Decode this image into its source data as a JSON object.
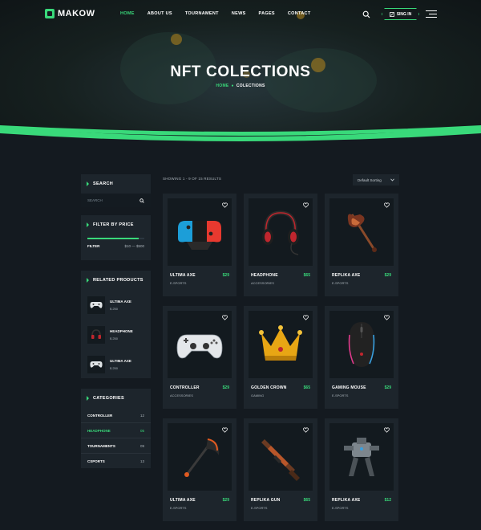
{
  "nav": {
    "logo": "MAKOW",
    "menu": [
      "HOME",
      "ABOUT US",
      "TOURNAMENT",
      "NEWS",
      "PAGES",
      "CONTACT"
    ],
    "active_index": 0,
    "signin_label": "SING IN"
  },
  "hero": {
    "title": "NFT COLECTIONS",
    "breadcrumb_home": "HOME",
    "breadcrumb_current": "COLECTIONS"
  },
  "sidebar": {
    "search": {
      "title": "SEARCH",
      "placeholder": "SEARCH"
    },
    "filter": {
      "title": "FILTER BY PRICE",
      "button": "FILTER",
      "range": "$10 — $500",
      "fill_fraction": 0.9
    },
    "related": {
      "title": "RELATED PRODUCTS",
      "items": [
        {
          "name": "ULTIMA AXE",
          "price": "$ 250",
          "icon": "gamepad-icon"
        },
        {
          "name": "HEADPHONE",
          "price": "$ 250",
          "icon": "headphone-icon"
        },
        {
          "name": "ULTIMA AXE",
          "price": "$ 250",
          "icon": "gamepad-icon"
        }
      ]
    },
    "categories": {
      "title": "CATEGORIES",
      "items": [
        {
          "name": "CONTROLLER",
          "count": "12"
        },
        {
          "name": "HEADPHONE",
          "count": "05"
        },
        {
          "name": "TOURNAMENTS",
          "count": "09"
        },
        {
          "name": "CSPORTS",
          "count": "13"
        }
      ],
      "active_index": 1
    }
  },
  "shop": {
    "results_text": "SHOWING 1 - 9 OF 15 RESULTS",
    "sorting": "Default Sorting",
    "products": [
      {
        "name": "ULTIMA AXE",
        "price": "$29",
        "category": "E-SPORTS",
        "icon": "switch-controller-icon"
      },
      {
        "name": "HEADPHONE",
        "price": "$65",
        "category": "ACCESSORIES",
        "icon": "headphone-icon"
      },
      {
        "name": "REPLIKA AXE",
        "price": "$29",
        "category": "E-SPORTS",
        "icon": "axe-icon"
      },
      {
        "name": "CONTROLLER",
        "price": "$29",
        "category": "ACCESSORIES",
        "icon": "gamepad-icon"
      },
      {
        "name": "GOLDEN CROWN",
        "price": "$65",
        "category": "GAMING",
        "icon": "crown-icon"
      },
      {
        "name": "GAMING MOUSE",
        "price": "$29",
        "category": "E-SPORTS",
        "icon": "mouse-icon"
      },
      {
        "name": "ULTIMA AXE",
        "price": "$29",
        "category": "E-SPORTS",
        "icon": "scythe-icon"
      },
      {
        "name": "REPLIKA GUN",
        "price": "$65",
        "category": "E-SPORTS",
        "icon": "rifle-icon"
      },
      {
        "name": "REPLIKA AXE",
        "price": "$12",
        "category": "E-SPORTS",
        "icon": "mech-robot-icon"
      }
    ]
  },
  "colors": {
    "accent": "#39d97a",
    "background": "#141a20",
    "panel": "#1d252c",
    "image_bg": "#131a1f"
  }
}
